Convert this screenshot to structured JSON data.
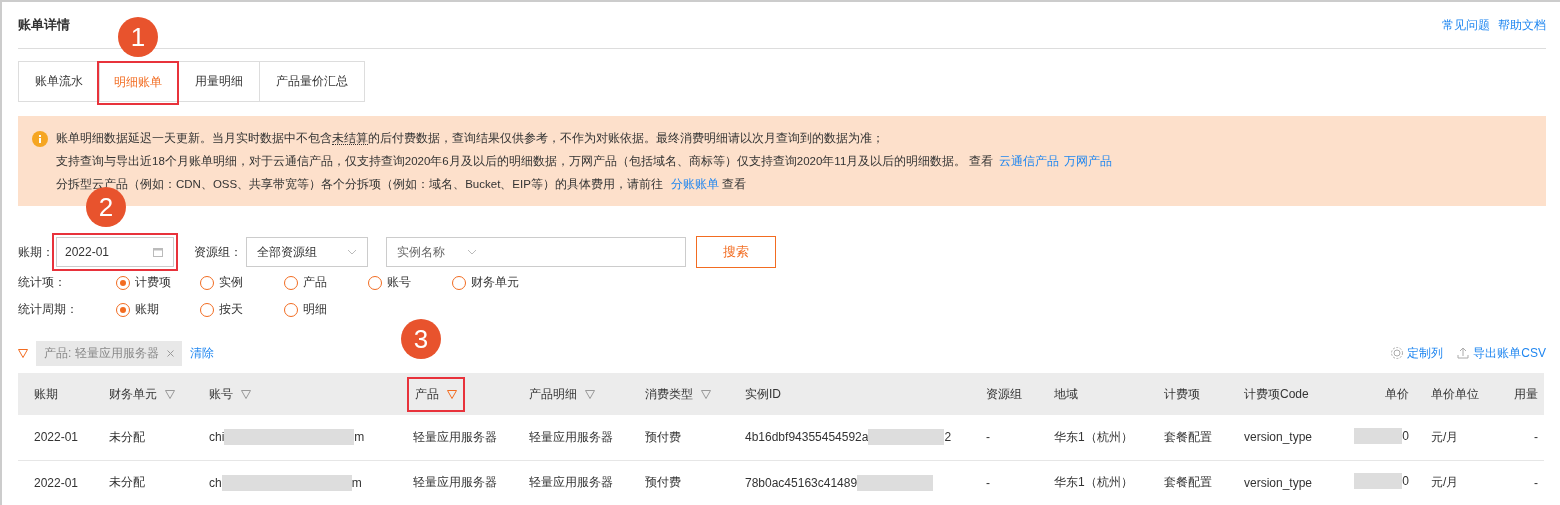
{
  "page": {
    "title": "账单详情",
    "links": [
      "常见问题",
      "帮助文档"
    ]
  },
  "tabs": [
    {
      "label": "账单流水",
      "selected": false,
      "highlighted": false
    },
    {
      "label": "明细账单",
      "selected": true,
      "highlighted": true,
      "callout": "1"
    },
    {
      "label": "用量明细",
      "selected": false,
      "highlighted": false
    },
    {
      "label": "产品量价汇总",
      "selected": false,
      "highlighted": false
    }
  ],
  "notice": {
    "lines": [
      [
        {
          "kind": "text",
          "text": "账单明细数据延迟一天更新。当月实时数据中不包含"
        },
        {
          "kind": "term",
          "text": "未结算"
        },
        {
          "kind": "text",
          "text": "的后付费数据，查询结果仅供参考，不作为对账依据。最终消费明细请以次月查询到的数据为准；"
        }
      ],
      [
        {
          "kind": "text",
          "text": "支持查询与导出近18个月账单明细，对于云通信产品，仅支持查询2020年6月及以后的明细数据，万网产品（包括域名、商标等）仅支持查询2020年11月及以后的明细数据。 查看"
        },
        {
          "kind": "link",
          "text": "云通信产品"
        },
        {
          "kind": "link",
          "text": "万网产品"
        }
      ],
      [
        {
          "kind": "text",
          "text": "分拆型云产品（例如：CDN、OSS、共享带宽等）各个分拆项（例如：域名、Bucket、EIP等）的具体费用，请前往 "
        },
        {
          "kind": "link",
          "text": "分账账单"
        },
        {
          "kind": "text",
          "text": " 查看"
        }
      ]
    ]
  },
  "filters": {
    "period_label": "账期：",
    "period_value": "2022-01",
    "period_highlighted": true,
    "period_callout": "2",
    "group_label": "资源组：",
    "group_value": "全部资源组",
    "instance_placeholder": "实例名称",
    "search_button": "搜索"
  },
  "radio_groups": [
    {
      "label": "统计项：",
      "options": [
        {
          "label": "计费项",
          "selected": true
        },
        {
          "label": "实例",
          "selected": false
        },
        {
          "label": "产品",
          "selected": false
        },
        {
          "label": "账号",
          "selected": false
        },
        {
          "label": "财务单元",
          "selected": false
        }
      ]
    },
    {
      "label": "统计周期：",
      "options": [
        {
          "label": "账期",
          "selected": true
        },
        {
          "label": "按天",
          "selected": false
        },
        {
          "label": "明细",
          "selected": false
        }
      ]
    }
  ],
  "active_filter": {
    "chip": "产品: 轻量应用服务器",
    "clear": "清除"
  },
  "table_actions": [
    "定制列",
    "导出账单CSV"
  ],
  "table": {
    "columns": [
      {
        "label": "账期",
        "filterable": false
      },
      {
        "label": "财务单元",
        "filterable": true,
        "filter_active": false
      },
      {
        "label": "账号",
        "filterable": true,
        "filter_active": false
      },
      {
        "label": "产品",
        "filterable": true,
        "filter_active": true,
        "highlighted": true,
        "callout": "3"
      },
      {
        "label": "产品明细",
        "filterable": true,
        "filter_active": false
      },
      {
        "label": "消费类型",
        "filterable": true,
        "filter_active": false
      },
      {
        "label": "实例ID",
        "filterable": false
      },
      {
        "label": "资源组",
        "filterable": false
      },
      {
        "label": "地域",
        "filterable": false
      },
      {
        "label": "计费项",
        "filterable": false
      },
      {
        "label": "计费项Code",
        "filterable": false
      },
      {
        "label": "单价",
        "filterable": false
      },
      {
        "label": "单价单位",
        "filterable": false
      },
      {
        "label": "用量",
        "filterable": false
      }
    ],
    "rows": [
      [
        {
          "text": "2022-01"
        },
        {
          "text": "未分配"
        },
        {
          "masked": true,
          "before": "chi",
          "after": "m"
        },
        {
          "text": "轻量应用服务器"
        },
        {
          "text": "轻量应用服务器"
        },
        {
          "text": "预付费"
        },
        {
          "masked": true,
          "before": "4b16dbf94355454592a",
          "after": "2"
        },
        {
          "text": "-"
        },
        {
          "text": "华东1（杭州）"
        },
        {
          "text": "套餐配置"
        },
        {
          "text": "version_type"
        },
        {
          "masked": true,
          "after": "0"
        },
        {
          "text": "元/月"
        },
        {
          "text": "-"
        }
      ],
      [
        {
          "text": "2022-01"
        },
        {
          "text": "未分配"
        },
        {
          "masked": true,
          "before": "ch",
          "after": "m"
        },
        {
          "text": "轻量应用服务器"
        },
        {
          "text": "轻量应用服务器"
        },
        {
          "text": "预付费"
        },
        {
          "masked": true,
          "before": "78b0ac45163c41489"
        },
        {
          "text": "-"
        },
        {
          "text": "华东1（杭州）"
        },
        {
          "text": "套餐配置"
        },
        {
          "text": "version_type"
        },
        {
          "masked": true,
          "after": "0"
        },
        {
          "text": "元/月"
        },
        {
          "text": "-"
        }
      ]
    ]
  }
}
